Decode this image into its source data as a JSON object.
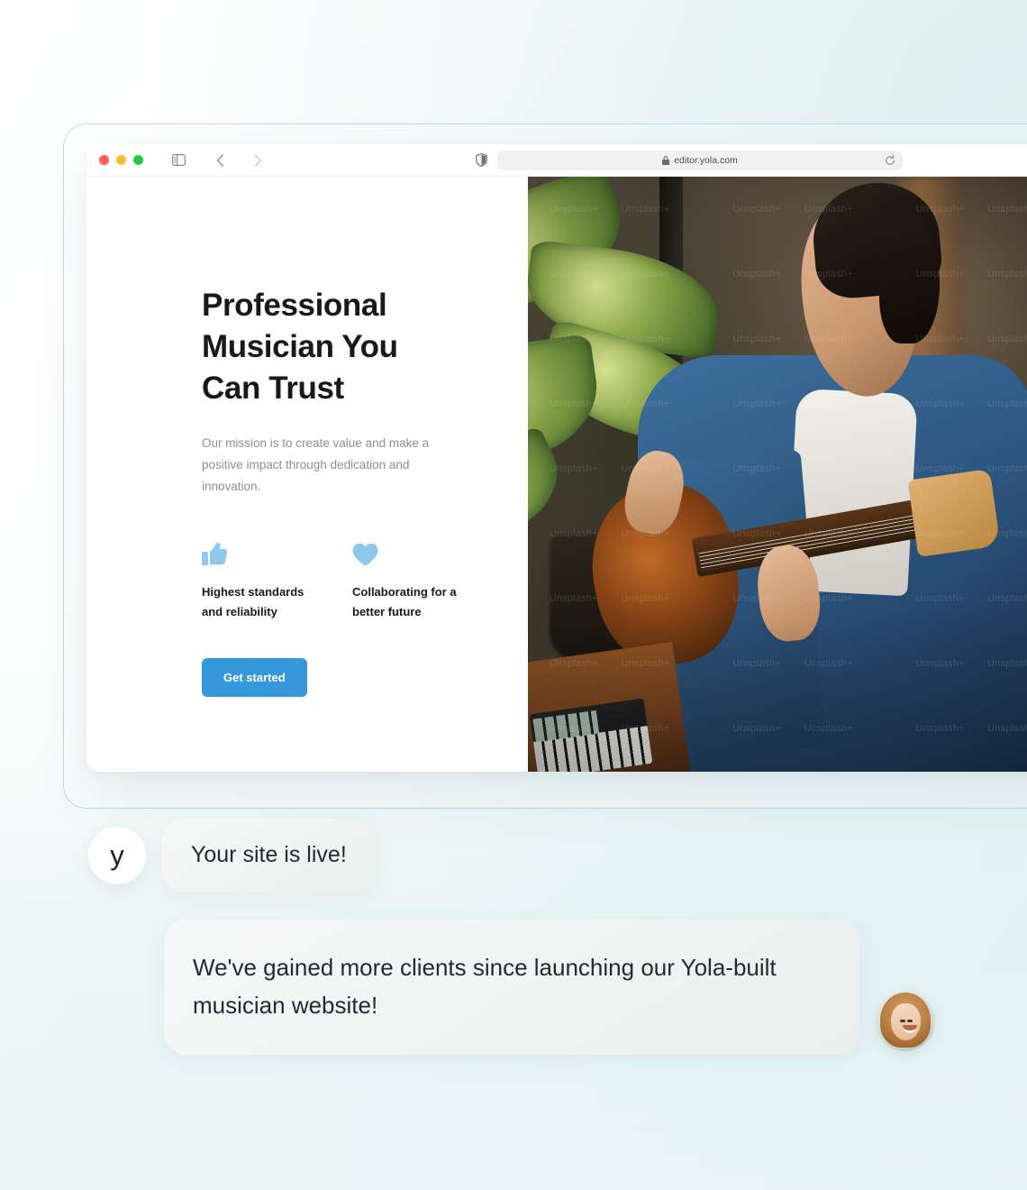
{
  "browser": {
    "url": "editor.yola.com",
    "lock_icon": "lock-icon",
    "reload_icon": "reload-icon",
    "sidebar_icon": "sidebar-toggle-icon",
    "back_icon": "chevron-left-icon",
    "forward_icon": "chevron-right-icon",
    "shield_icon": "shield-icon",
    "traffic_lights": [
      "close",
      "minimize",
      "maximize"
    ]
  },
  "site": {
    "title": "Professional Musician You Can Trust",
    "subtitle": "Our mission is to create value and make a positive impact through dedication and innovation.",
    "features": [
      {
        "icon": "thumbs-up-icon",
        "label": "Highest standards and reliability"
      },
      {
        "icon": "heart-icon",
        "label": "Collaborating for a better future"
      }
    ],
    "cta_label": "Get started",
    "hero_image_alt": "Musician playing a bass guitar beside a houseplant with a MIDI keyboard on a table",
    "hero_watermark": "Unsplash+"
  },
  "chat": {
    "brand_logo": "y",
    "messages": [
      {
        "author": "yola",
        "text": "Your site is live!"
      },
      {
        "author": "client",
        "text": "We've gained more clients since launching our Yola-built musician website!"
      }
    ]
  },
  "colors": {
    "accent_blue": "#3498db",
    "feature_icon_blue": "#8fc8ec",
    "frame_border": "#b8dced",
    "heading": "#18191b",
    "body_text": "#8b8f94"
  }
}
